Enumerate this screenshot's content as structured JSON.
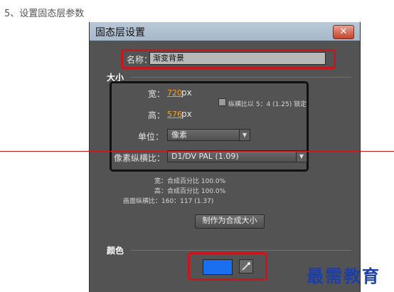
{
  "step_text": "5、设置固态层参数",
  "dialog": {
    "title": "固态层设置",
    "close_label": "✕",
    "name_label": "名称：",
    "name_value": "渐变背景",
    "size_section": "大小",
    "width_label": "宽：",
    "width_value": "720",
    "height_label": "高：",
    "height_value": "576",
    "px_unit": "px",
    "aspect_lock_label": "纵横比以 5：4 (1.25) 锁定",
    "unit_label": "单位：",
    "unit_value": "像素",
    "pixel_aspect_label": "像素纵横比：",
    "pixel_aspect_value": "D1/DV PAL (1.09)",
    "info_width": "宽：合成百分比 100.0%",
    "info_height": "高：合成百分比 100.0%",
    "info_frame_aspect": "画面纵横比：160：117 (1.37)",
    "make_comp_size_button": "制作为合成大小",
    "color_section": "颜色",
    "color_value": "#1a6ff0"
  },
  "watermark": "最需教育"
}
